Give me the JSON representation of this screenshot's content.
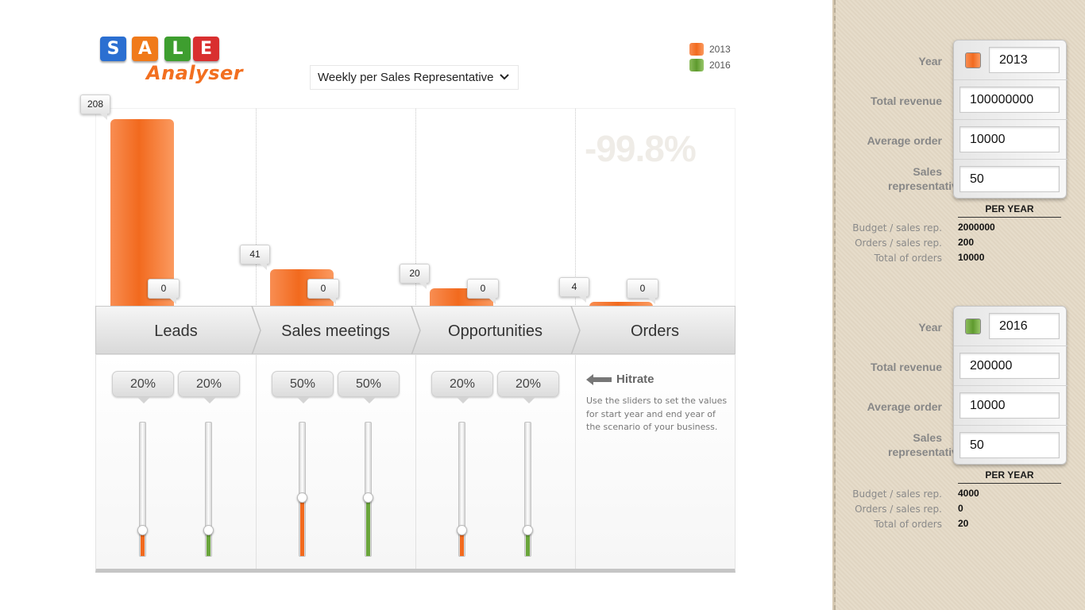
{
  "logo": {
    "letters": [
      "S",
      "A",
      "L",
      "E"
    ],
    "letter_colors": [
      "#2b6fd1",
      "#f07a1a",
      "#3e9e2f",
      "#d92f2f"
    ],
    "subtitle": "Analyser"
  },
  "view_select": {
    "value": "Weekly per Sales Representative"
  },
  "legend": [
    {
      "label": "2013",
      "color": "#f26a1e"
    },
    {
      "label": "2016",
      "color": "#6aa53b"
    }
  ],
  "colors": {
    "year_a": "#f26a1e",
    "year_b": "#6aa53b"
  },
  "change_pct": "-99.8%",
  "chart_data": {
    "type": "bar",
    "categories": [
      "Leads",
      "Sales meetings",
      "Opportunities",
      "Orders"
    ],
    "series": [
      {
        "name": "2013",
        "values": [
          208,
          41,
          20,
          4
        ],
        "labels": [
          "208",
          "41",
          "20",
          "4"
        ]
      },
      {
        "name": "2016",
        "values": [
          0,
          0,
          0,
          0
        ],
        "labels": [
          "0",
          "0",
          "0",
          "0"
        ]
      }
    ],
    "ylim": [
      0,
      208
    ]
  },
  "stages": [
    "Leads",
    "Sales meetings",
    "Opportunities",
    "Orders"
  ],
  "hitrates": [
    {
      "a": "20%",
      "b": "20%",
      "a_value": 0.2,
      "b_value": 0.2
    },
    {
      "a": "50%",
      "b": "50%",
      "a_value": 0.5,
      "b_value": 0.5
    },
    {
      "a": "20%",
      "b": "20%",
      "a_value": 0.2,
      "b_value": 0.2
    }
  ],
  "hitrate_title": "Hitrate",
  "hitrate_hint": "Use the sliders to set the values for start year and end year of the scenario of your business.",
  "labels": {
    "year": "Year",
    "total_revenue": "Total revenue",
    "average_order": "Average order",
    "sales_reps": "Sales representatives",
    "per_year": "PER YEAR",
    "budget": "Budget / sales rep.",
    "orders": "Orders / sales rep.",
    "total_orders": "Total of orders"
  },
  "scenarios": [
    {
      "year": "2013",
      "total_revenue": "100000000",
      "average_order": "10000",
      "sales_reps": "50",
      "budget": "2000000",
      "orders": "200",
      "total_orders": "10000"
    },
    {
      "year": "2016",
      "total_revenue": "200000",
      "average_order": "10000",
      "sales_reps": "50",
      "budget": "4000",
      "orders": "0",
      "total_orders": "20"
    }
  ]
}
